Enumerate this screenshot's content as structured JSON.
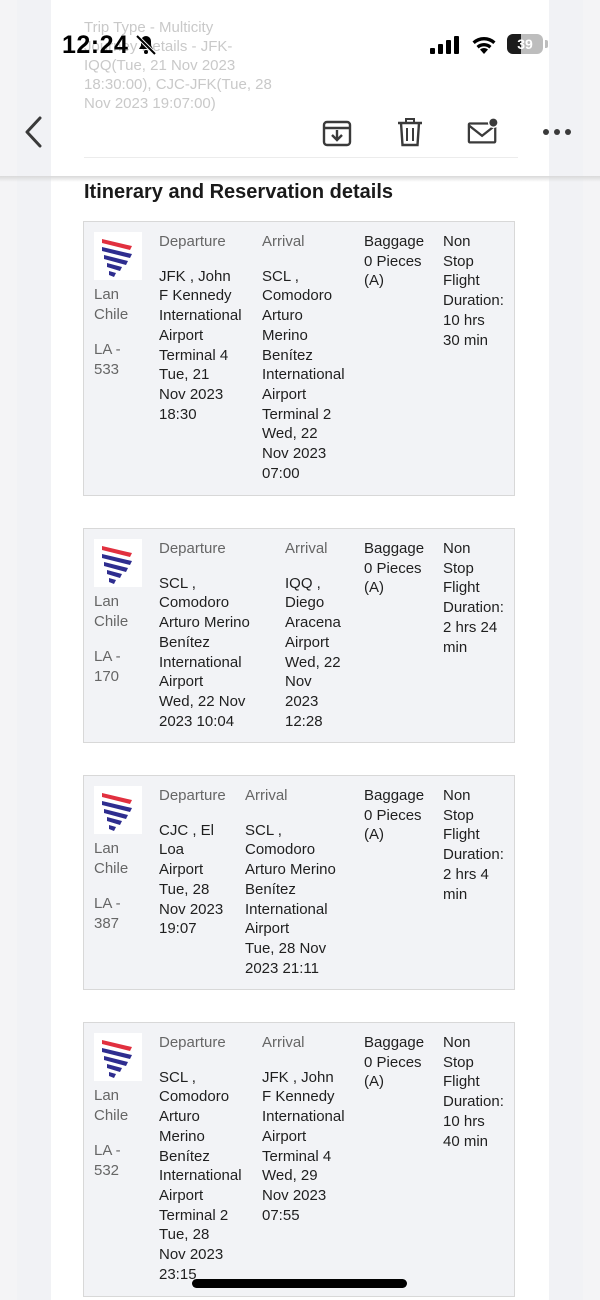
{
  "background_email": {
    "trip_type": "Trip Type - Multicity",
    "journey_details": "Journey Details - JFK-\nIQQ(Tue, 21 Nov 2023\n18:30:00), CJC-JFK(Tue, 28\nNov 2023 19:07:00)"
  },
  "status_bar": {
    "time": "12:24",
    "battery_level": "39",
    "battery_fraction": 0.39,
    "icons": [
      "bell-slash-icon",
      "cellular-signal-icon",
      "wifi-icon",
      "battery-icon"
    ]
  },
  "toolbar": {
    "icons": [
      "back-chevron-icon",
      "archive-icon",
      "trash-icon",
      "mail-unread-icon",
      "more-icon"
    ]
  },
  "section_title": "Itinerary and Reservation details",
  "departure_label": "Departure",
  "arrival_label": "Arrival",
  "baggage_label": "Baggage",
  "baggage_value": "0 Pieces\n(A)",
  "duration_prefix": "Non\nStop\nFlight\nDuration:",
  "brand_colors": {
    "red": "#e1303f",
    "indigo": "#2e2d8f"
  },
  "flights": [
    {
      "airline": "Lan\nChile",
      "flight_no": "LA -\n533",
      "departure": "JFK , John\nF Kennedy\nInternational\nAirport\nTerminal 4\nTue, 21\nNov 2023\n18:30",
      "arrival": "SCL ,\nComodoro\nArturo\nMerino\nBenítez\nInternational\nAirport\nTerminal 2\nWed, 22\nNov 2023\n07:00",
      "duration": "10 hrs\n30 min"
    },
    {
      "airline": "Lan\nChile",
      "flight_no": "LA -\n170",
      "departure": "SCL ,\nComodoro\nArturo Merino\nBenítez\nInternational\nAirport\nWed, 22 Nov\n2023 10:04",
      "arrival": "IQQ ,\nDiego\nAracena\nAirport\nWed, 22\nNov\n2023\n12:28",
      "duration": "2 hrs 24\nmin"
    },
    {
      "airline": "Lan\nChile",
      "flight_no": "LA -\n387",
      "departure": "CJC , El\nLoa\nAirport\nTue, 28\nNov 2023\n19:07",
      "arrival": "SCL ,\nComodoro\nArturo Merino\nBenítez\nInternational\nAirport\nTue, 28 Nov\n2023 21:11",
      "duration": "2 hrs 4\nmin"
    },
    {
      "airline": "Lan\nChile",
      "flight_no": "LA -\n532",
      "departure": "SCL ,\nComodoro\nArturo\nMerino\nBenítez\nInternational\nAirport\nTerminal 2\nTue, 28\nNov 2023\n23:15",
      "arrival": "JFK , John\nF Kennedy\nInternational\nAirport\nTerminal 4\nWed, 29\nNov 2023\n07:55",
      "duration": "10 hrs\n40 min"
    }
  ]
}
